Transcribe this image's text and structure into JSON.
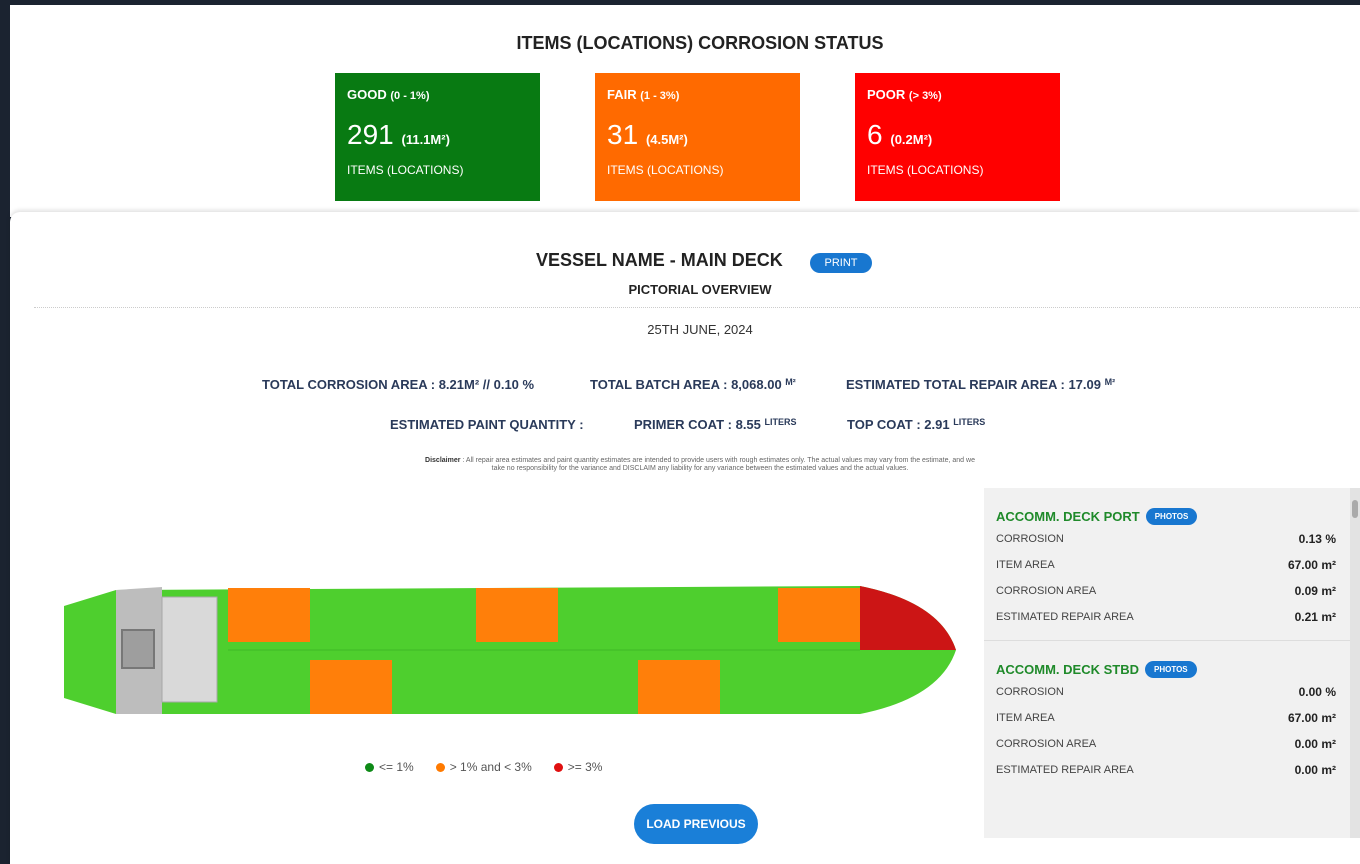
{
  "status": {
    "title": "ITEMS (LOCATIONS) CORROSION STATUS",
    "cards": [
      {
        "label": "GOOD",
        "range": "(0 - 1%)",
        "count": "291",
        "area": "(11.1M²)",
        "sub": "ITEMS (LOCATIONS)",
        "color": "#087a12"
      },
      {
        "label": "FAIR",
        "range": "(1 - 3%)",
        "count": "31",
        "area": "(4.5M²)",
        "sub": "ITEMS (LOCATIONS)",
        "color": "#ff6a00"
      },
      {
        "label": "POOR",
        "range": "(> 3%)",
        "count": "6",
        "area": "(0.2M²)",
        "sub": "ITEMS (LOCATIONS)",
        "color": "#ff0000"
      }
    ]
  },
  "overview": {
    "vessel_title": "VESSEL NAME - MAIN DECK",
    "print_label": "PRINT",
    "subtitle": "PICTORIAL OVERVIEW",
    "date": "25TH JUNE, 2024"
  },
  "stats": {
    "total_corrosion": "TOTAL CORROSION AREA : 8.21M² // 0.10 %",
    "total_batch": "TOTAL BATCH AREA : 8,068.00",
    "total_batch_unit": "M²",
    "repair_area": "ESTIMATED TOTAL REPAIR AREA : 17.09",
    "repair_area_unit": "M²",
    "paint_label": "ESTIMATED PAINT QUANTITY :",
    "primer": "PRIMER COAT : 8.55",
    "primer_unit": "LITERS",
    "top_coat": "TOP COAT : 2.91",
    "top_coat_unit": "LITERS"
  },
  "disclaimer": {
    "label": "Disclaimer",
    "text": " : All repair area estimates and paint quantity estimates are intended to provide users with rough estimates only. The actual values may vary from the estimate, and we take no responsibility for the variance and DISCLAIM any liability for any variance between the estimated values and the actual values."
  },
  "legend": [
    {
      "label": "<= 1%",
      "color": "#0e8a17"
    },
    {
      "label": "> 1% and < 3%",
      "color": "#ff7a00"
    },
    {
      "label": ">= 3%",
      "color": "#e01010"
    }
  ],
  "load_previous_label": "LOAD PREVIOUS",
  "colors": {
    "good": "#4ecf2e",
    "fair": "#ff7f0a",
    "poor": "#cc1515",
    "accent": "#1877d0"
  },
  "side_panel": {
    "sections": [
      {
        "name": "ACCOMM. DECK PORT",
        "photos_label": "PHOTOS",
        "rows": [
          {
            "label": "CORROSION",
            "value": "0.13",
            "unit": "%"
          },
          {
            "label": "ITEM AREA",
            "value": "67.00",
            "unit": "m²"
          },
          {
            "label": "CORROSION AREA",
            "value": "0.09",
            "unit": "m²"
          },
          {
            "label": "ESTIMATED REPAIR AREA",
            "value": "0.21",
            "unit": "m²"
          }
        ]
      },
      {
        "name": "ACCOMM. DECK STBD",
        "photos_label": "PHOTOS",
        "rows": [
          {
            "label": "CORROSION",
            "value": "0.00",
            "unit": "%"
          },
          {
            "label": "ITEM AREA",
            "value": "67.00",
            "unit": "m²"
          },
          {
            "label": "CORROSION AREA",
            "value": "0.00",
            "unit": "m²"
          },
          {
            "label": "ESTIMATED REPAIR AREA",
            "value": "0.00",
            "unit": "m²"
          }
        ]
      }
    ]
  }
}
